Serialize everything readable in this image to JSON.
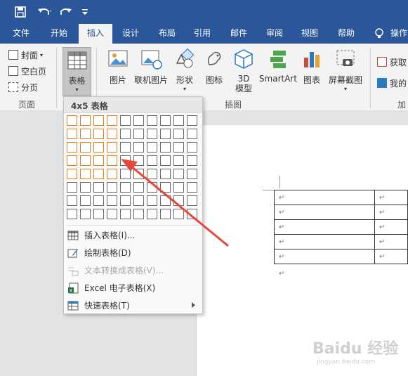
{
  "qat": {
    "save_icon": "save-icon",
    "undo_icon": "undo-icon",
    "redo_icon": "redo-icon",
    "customize_icon": "customize-icon"
  },
  "tabs": [
    "文件",
    "开始",
    "插入",
    "设计",
    "布局",
    "引用",
    "邮件",
    "审阅",
    "视图",
    "帮助",
    "操作"
  ],
  "active_tab": "插入",
  "pages_group": {
    "cover": "封面",
    "blank": "空白页",
    "break": "分页",
    "label": "页面"
  },
  "table_group": {
    "label": "表格"
  },
  "illustrations": {
    "picture": "图片",
    "online_picture": "联机图片",
    "shapes": "形状",
    "icons": "图标",
    "model3d": "3D\n模型",
    "smartart": "SmartArt",
    "chart": "图表",
    "screenshot": "屏幕截图",
    "label": "插图"
  },
  "addins": {
    "get": "获取",
    "my": "我的",
    "label": "加"
  },
  "dropdown": {
    "title": "4x5 表格",
    "rows": 8,
    "cols": 10,
    "selected_rows": 5,
    "selected_cols": 4,
    "items": [
      {
        "label": "插入表格(I)...",
        "icon": "insert-table-icon",
        "disabled": false
      },
      {
        "label": "绘制表格(D)",
        "icon": "draw-table-icon",
        "disabled": false
      },
      {
        "label": "文本转换成表格(V)...",
        "icon": "text-to-table-icon",
        "disabled": true
      },
      {
        "label": "Excel 电子表格(X)",
        "icon": "excel-icon",
        "disabled": false
      },
      {
        "label": "快速表格(T)",
        "icon": "quick-tables-icon",
        "disabled": false,
        "submenu": true
      }
    ]
  },
  "document": {
    "mark": "↵",
    "table_rows": 5
  },
  "watermark": {
    "brand": "Baidu 经验",
    "url": "jingyan.baidu.com"
  }
}
